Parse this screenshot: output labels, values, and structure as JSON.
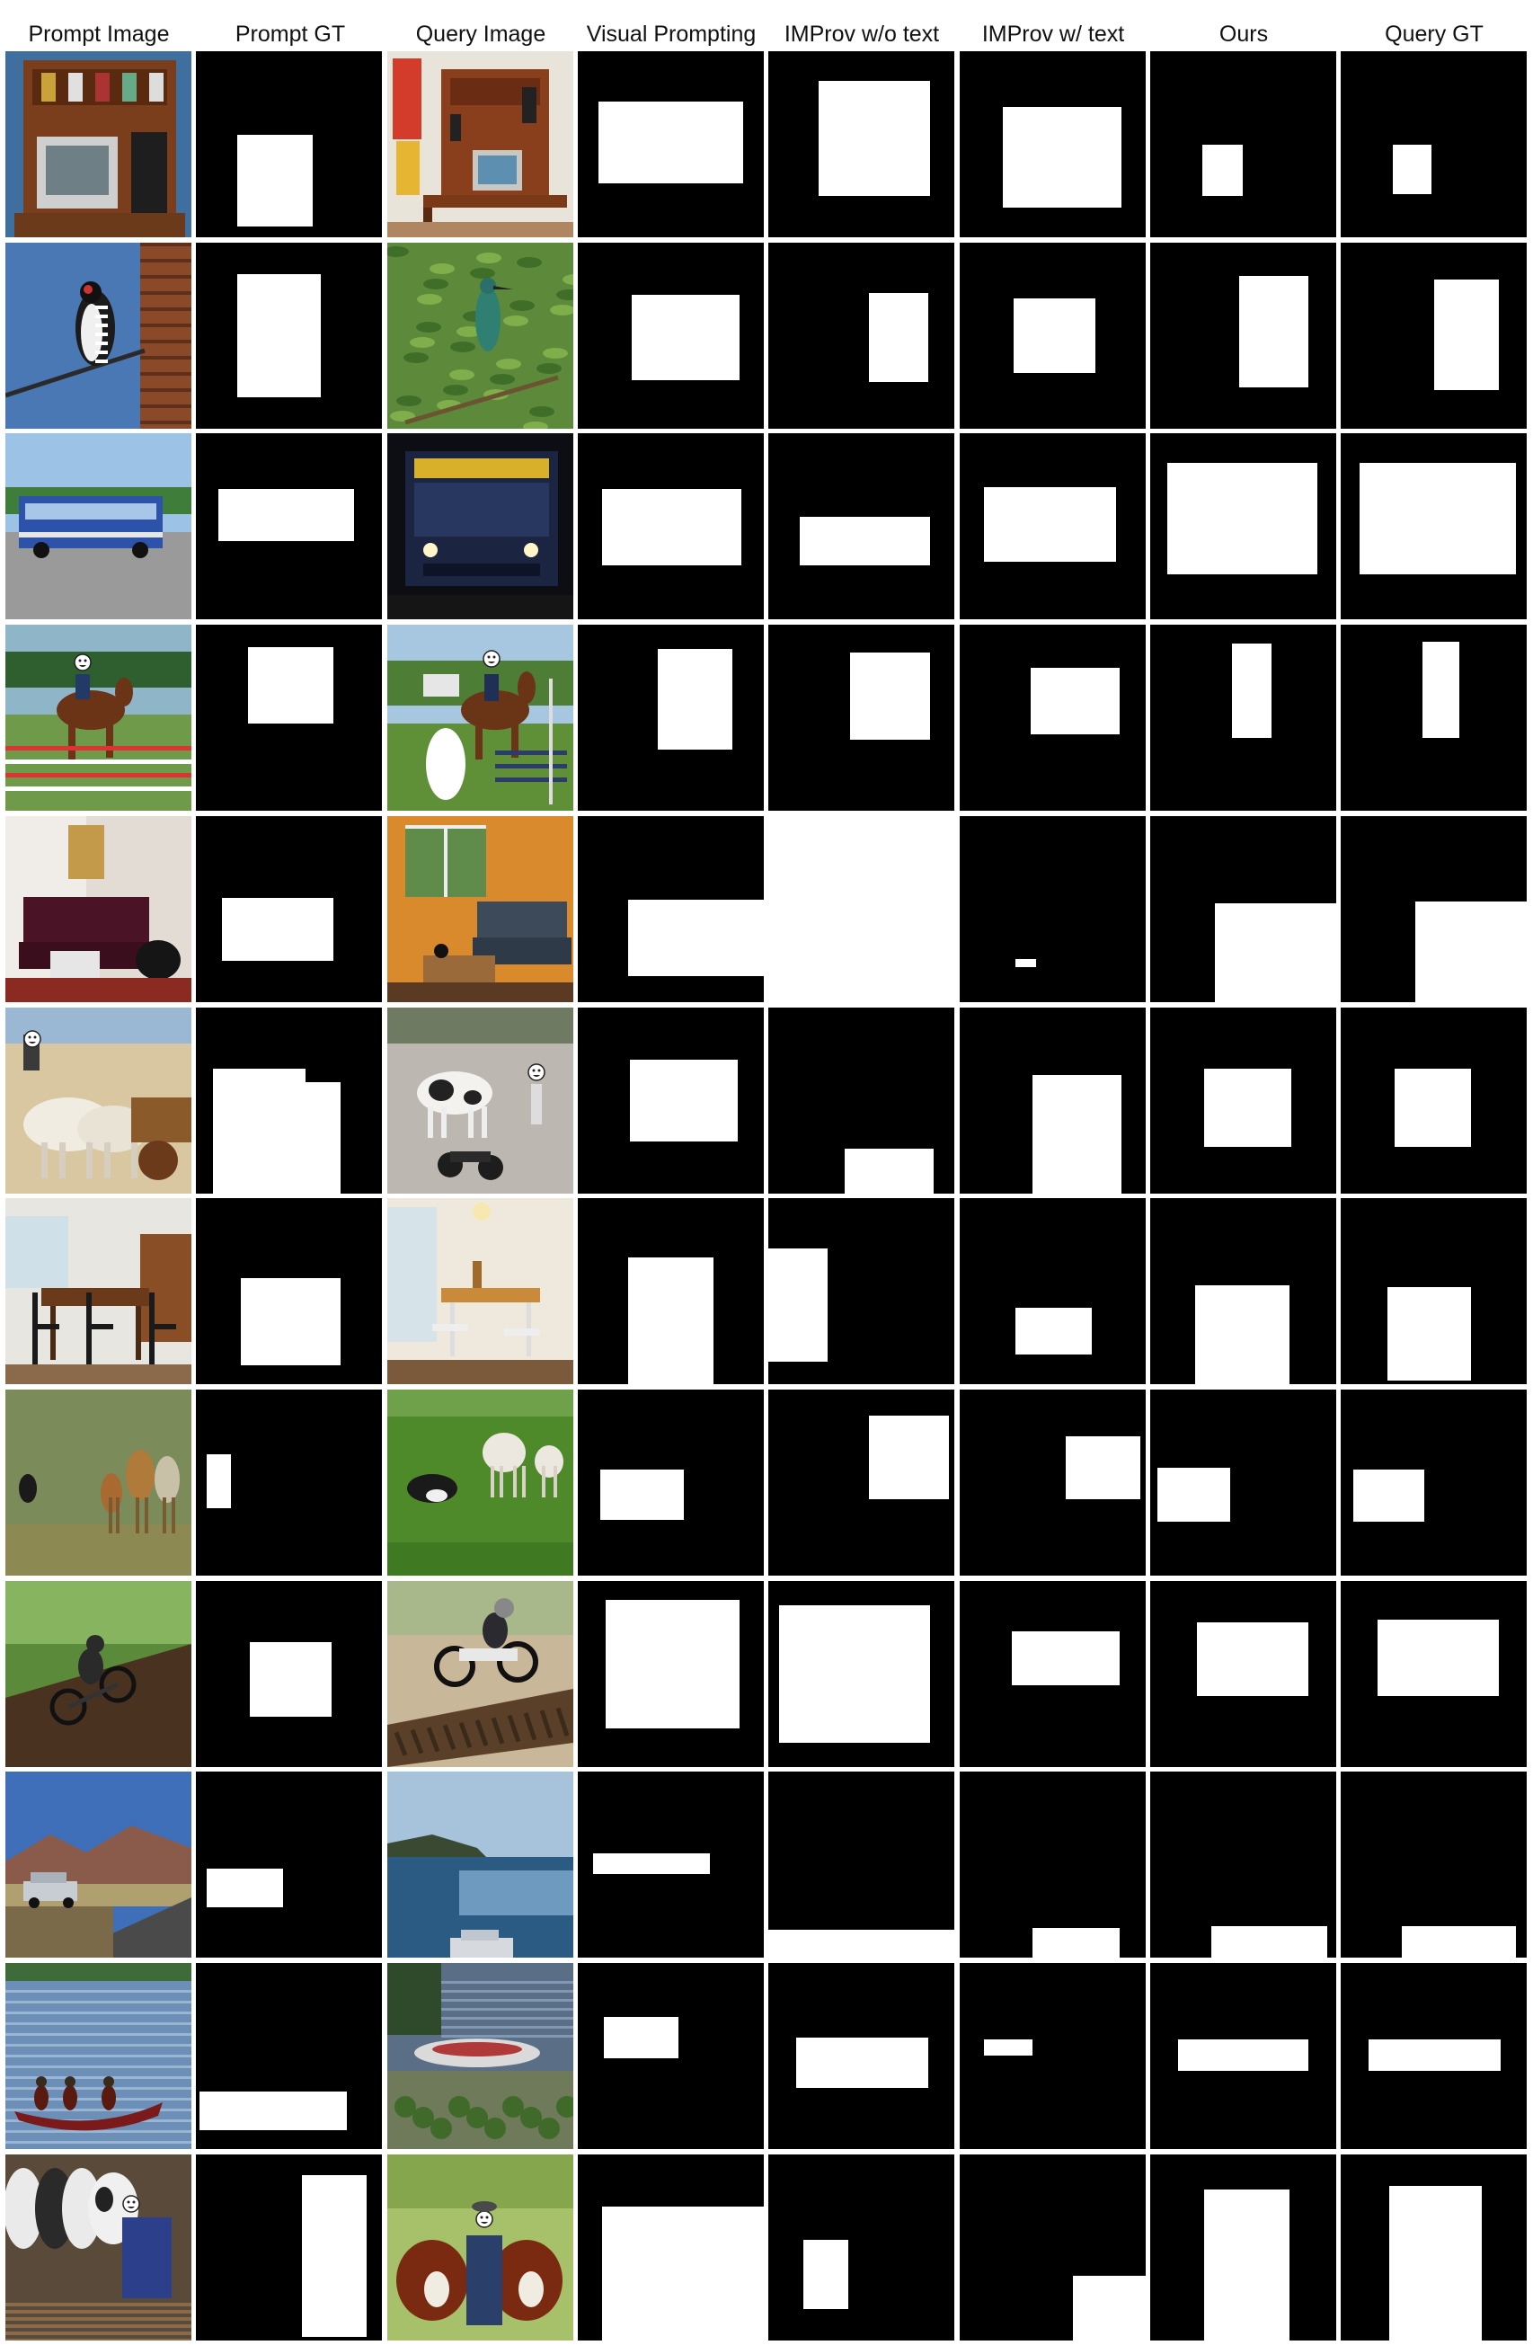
{
  "columns": [
    "Prompt Image",
    "Prompt GT",
    "Query Image",
    "Visual Prompting",
    "IMProv w/o text",
    "IMProv w/ text",
    "Ours",
    "Query GT"
  ],
  "colors": {
    "background": "#ffffff",
    "mask_background": "#000000",
    "mask_foreground": "#ffffff"
  },
  "rows": [
    {
      "prompt_scene": "desk-computer-shelf",
      "query_scene": "desk-computer-posters",
      "masks": [
        [
          [
            0.22,
            0.45,
            0.63,
            0.94
          ]
        ],
        [
          [
            0.11,
            0.27,
            0.89,
            0.71
          ]
        ],
        [
          [
            0.27,
            0.16,
            0.87,
            0.78
          ]
        ],
        [
          [
            0.23,
            0.3,
            0.87,
            0.84
          ]
        ],
        [
          [
            0.28,
            0.5,
            0.5,
            0.78
          ]
        ],
        [
          [
            0.28,
            0.5,
            0.49,
            0.77
          ]
        ]
      ]
    },
    {
      "prompt_scene": "woodpecker-on-tree",
      "query_scene": "bird-on-branch",
      "masks": [
        [
          [
            0.22,
            0.17,
            0.67,
            0.83
          ]
        ],
        [
          [
            0.29,
            0.28,
            0.87,
            0.74
          ]
        ],
        [
          [
            0.54,
            0.27,
            0.86,
            0.75
          ]
        ],
        [
          [
            0.29,
            0.3,
            0.73,
            0.7
          ]
        ],
        [
          [
            0.48,
            0.18,
            0.85,
            0.78
          ]
        ],
        [
          [
            0.5,
            0.2,
            0.85,
            0.79
          ]
        ]
      ]
    },
    {
      "prompt_scene": "city-bus",
      "query_scene": "bus-at-night",
      "masks": [
        [
          [
            0.12,
            0.3,
            0.85,
            0.58
          ]
        ],
        [
          [
            0.13,
            0.3,
            0.88,
            0.71
          ]
        ],
        [
          [
            0.17,
            0.45,
            0.87,
            0.71
          ]
        ],
        [
          [
            0.13,
            0.29,
            0.84,
            0.69
          ]
        ],
        [
          [
            0.09,
            0.16,
            0.9,
            0.76
          ]
        ],
        [
          [
            0.1,
            0.16,
            0.94,
            0.76
          ]
        ]
      ]
    },
    {
      "prompt_scene": "horse-show-jumping",
      "query_scene": "horse-rider-jump",
      "masks": [
        [
          [
            0.28,
            0.12,
            0.74,
            0.53
          ]
        ],
        [
          [
            0.43,
            0.13,
            0.83,
            0.67
          ]
        ],
        [
          [
            0.44,
            0.15,
            0.87,
            0.62
          ]
        ],
        [
          [
            0.38,
            0.23,
            0.86,
            0.59
          ]
        ],
        [
          [
            0.44,
            0.1,
            0.65,
            0.61
          ]
        ],
        [
          [
            0.44,
            0.09,
            0.64,
            0.61
          ]
        ]
      ]
    },
    {
      "prompt_scene": "living-room-sofa",
      "query_scene": "living-room-couch",
      "masks": [
        [
          [
            0.14,
            0.44,
            0.74,
            0.78
          ]
        ],
        [
          [
            0.27,
            0.45,
            1.0,
            0.86
          ]
        ],
        [
          [
            0.0,
            0.0,
            1.0,
            1.0
          ]
        ],
        [
          [
            0.3,
            0.77,
            0.41,
            0.81
          ]
        ],
        [
          [
            0.35,
            0.47,
            1.0,
            1.0
          ]
        ],
        [
          [
            0.4,
            0.46,
            1.0,
            1.0
          ]
        ]
      ]
    },
    {
      "prompt_scene": "ox-cart-street",
      "query_scene": "cow-and-motorbikes",
      "masks": [
        [
          [
            0.09,
            0.33,
            0.59,
            1.0
          ],
          [
            0.55,
            0.4,
            0.78,
            1.0
          ]
        ],
        [
          [
            0.28,
            0.28,
            0.86,
            0.72
          ]
        ],
        [
          [
            0.41,
            0.76,
            0.89,
            1.0
          ]
        ],
        [
          [
            0.39,
            0.36,
            0.87,
            1.0
          ]
        ],
        [
          [
            0.29,
            0.33,
            0.76,
            0.75
          ]
        ],
        [
          [
            0.29,
            0.33,
            0.7,
            0.75
          ]
        ]
      ]
    },
    {
      "prompt_scene": "dining-room-table",
      "query_scene": "dining-room-chairs",
      "masks": [
        [
          [
            0.24,
            0.43,
            0.78,
            0.9
          ]
        ],
        [
          [
            0.27,
            0.32,
            0.73,
            1.0
          ]
        ],
        [
          [
            0.0,
            0.27,
            0.32,
            0.88
          ]
        ],
        [
          [
            0.3,
            0.59,
            0.71,
            0.84
          ]
        ],
        [
          [
            0.24,
            0.47,
            0.75,
            1.0
          ]
        ],
        [
          [
            0.25,
            0.48,
            0.7,
            0.98
          ]
        ]
      ]
    },
    {
      "prompt_scene": "goats-on-hill",
      "query_scene": "dog-and-goats",
      "masks": [
        [
          [
            0.06,
            0.35,
            0.19,
            0.64
          ]
        ],
        [
          [
            0.12,
            0.43,
            0.57,
            0.7
          ]
        ],
        [
          [
            0.54,
            0.14,
            0.97,
            0.59
          ]
        ],
        [
          [
            0.57,
            0.25,
            0.97,
            0.59
          ]
        ],
        [
          [
            0.04,
            0.42,
            0.43,
            0.71
          ]
        ],
        [
          [
            0.07,
            0.43,
            0.45,
            0.71
          ]
        ]
      ]
    },
    {
      "prompt_scene": "mountain-biker-forest",
      "query_scene": "dirt-bike-ramp",
      "masks": [
        [
          [
            0.29,
            0.33,
            0.73,
            0.73
          ]
        ],
        [
          [
            0.15,
            0.1,
            0.87,
            0.79
          ]
        ],
        [
          [
            0.06,
            0.13,
            0.87,
            0.87
          ]
        ],
        [
          [
            0.28,
            0.27,
            0.86,
            0.56
          ]
        ],
        [
          [
            0.25,
            0.22,
            0.85,
            0.62
          ]
        ],
        [
          [
            0.2,
            0.21,
            0.85,
            0.62
          ]
        ]
      ]
    },
    {
      "prompt_scene": "car-mountain-road",
      "query_scene": "sea-coast-car",
      "masks": [
        [
          [
            0.06,
            0.52,
            0.47,
            0.73
          ]
        ],
        [
          [
            0.08,
            0.44,
            0.71,
            0.55
          ]
        ],
        [
          [
            0.0,
            0.85,
            1.0,
            1.0
          ]
        ],
        [
          [
            0.39,
            0.84,
            0.86,
            1.0
          ]
        ],
        [
          [
            0.33,
            0.83,
            0.95,
            1.0
          ]
        ],
        [
          [
            0.33,
            0.83,
            0.94,
            1.0
          ]
        ]
      ]
    },
    {
      "prompt_scene": "canoe-on-lake",
      "query_scene": "kayak-on-shore",
      "masks": [
        [
          [
            0.02,
            0.69,
            0.81,
            0.9
          ]
        ],
        [
          [
            0.14,
            0.29,
            0.54,
            0.51
          ]
        ],
        [
          [
            0.15,
            0.4,
            0.86,
            0.67
          ]
        ],
        [
          [
            0.13,
            0.41,
            0.39,
            0.5
          ]
        ],
        [
          [
            0.15,
            0.41,
            0.85,
            0.58
          ]
        ],
        [
          [
            0.15,
            0.41,
            0.86,
            0.58
          ]
        ]
      ]
    },
    {
      "prompt_scene": "cows-on-boardwalk",
      "query_scene": "farmer-with-cows",
      "masks": [
        [
          [
            0.57,
            0.11,
            0.92,
            0.98
          ]
        ],
        [
          [
            0.13,
            0.28,
            1.0,
            1.0
          ]
        ],
        [
          [
            0.19,
            0.46,
            0.43,
            0.83
          ]
        ],
        [
          [
            0.61,
            0.65,
            1.0,
            1.0
          ]
        ],
        [
          [
            0.29,
            0.19,
            0.75,
            1.0
          ]
        ],
        [
          [
            0.26,
            0.17,
            0.76,
            1.0
          ]
        ]
      ]
    }
  ]
}
